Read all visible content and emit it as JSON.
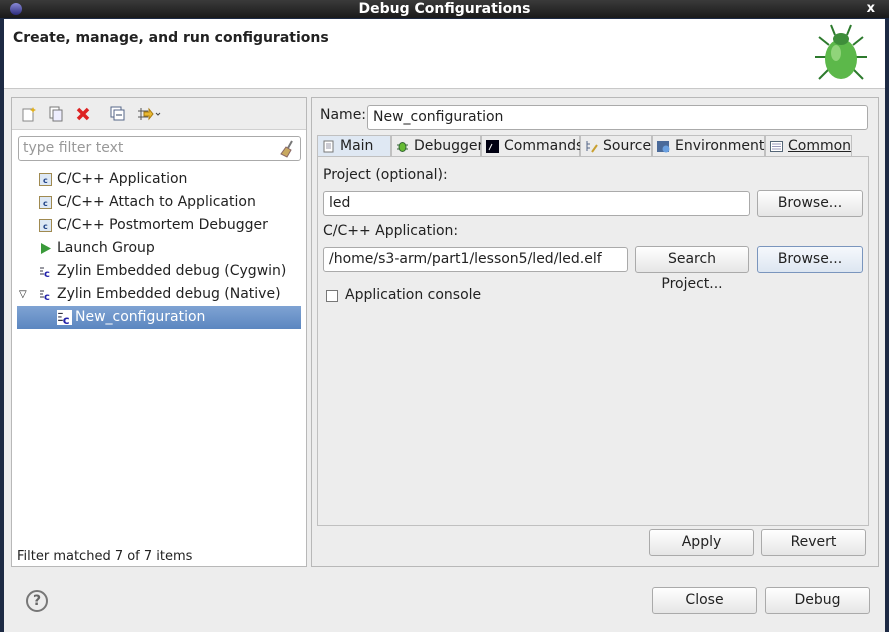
{
  "window": {
    "title": "Debug Configurations"
  },
  "header": {
    "title": "Create, manage, and run configurations"
  },
  "left": {
    "filter_placeholder": "type filter text",
    "toolbar": [
      "new-configuration",
      "duplicate",
      "delete",
      "collapse-all",
      "filter"
    ],
    "tree": [
      {
        "label": "C/C++ Application",
        "icon": "c-app-icon"
      },
      {
        "label": "C/C++ Attach to Application",
        "icon": "c-app-icon"
      },
      {
        "label": "C/C++ Postmortem Debugger",
        "icon": "c-app-icon"
      },
      {
        "label": "Launch Group",
        "icon": "launch-icon"
      },
      {
        "label": "Zylin Embedded debug (Cygwin)",
        "icon": "zylin-icon"
      },
      {
        "label": "Zylin Embedded debug (Native)",
        "icon": "zylin-icon",
        "expanded": true
      },
      {
        "label": "New_configuration",
        "icon": "zylin-icon",
        "selected": true
      }
    ],
    "status": "Filter matched 7 of 7 items"
  },
  "right": {
    "name_label": "Name:",
    "name_value": "New_configuration",
    "tabs": [
      "Main",
      "Debugger",
      "Commands",
      "Source",
      "Environment",
      "Common"
    ],
    "project_label": "Project (optional):",
    "project_value": "led",
    "browse": "Browse...",
    "app_label": "C/C++ Application:",
    "app_value": "/home/s3-arm/part1/lesson5/led/led.elf",
    "search_project": "Search Project...",
    "app_console": "Application console",
    "app_console_checked": false,
    "apply": "Apply",
    "revert": "Revert"
  },
  "footer": {
    "help": "?",
    "close": "Close",
    "debug": "Debug"
  }
}
